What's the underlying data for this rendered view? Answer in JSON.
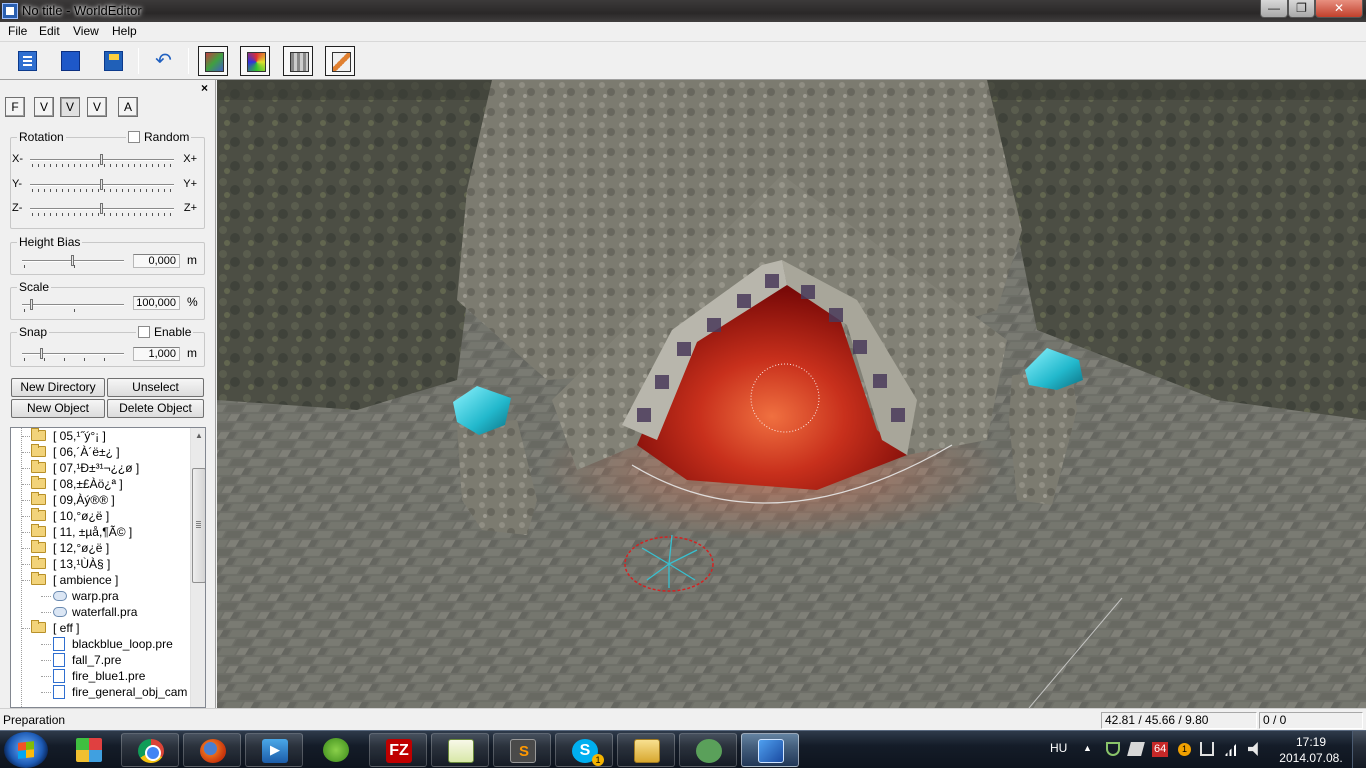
{
  "window": {
    "title": "No title - WorldEditor",
    "minimize_glyph": "—",
    "maximize_glyph": "❐",
    "close_glyph": "✕"
  },
  "menu": [
    "File",
    "Edit",
    "View",
    "Help"
  ],
  "toolbar": {
    "icons": [
      "new-file-icon",
      "open-folder-icon",
      "save-icon",
      "undo-icon",
      "object-mode-icon",
      "texture-mode-icon",
      "attribute-mode-icon",
      "edit-mode-icon"
    ],
    "undo_glyph": "↶"
  },
  "panel": {
    "close_glyph": "×",
    "mode_tabs": [
      "F",
      "V",
      "V",
      "V",
      "A"
    ],
    "rotation": {
      "title": "Rotation",
      "random_label": "Random",
      "random_checked": false,
      "axes": [
        {
          "left": "X-",
          "right": "X+",
          "level": 0.5
        },
        {
          "left": "Y-",
          "right": "Y+",
          "level": 0.5
        },
        {
          "left": "Z-",
          "right": "Z+",
          "level": 0.5
        }
      ]
    },
    "height_bias": {
      "title": "Height Bias",
      "value": "0,000",
      "unit": "m",
      "level": 0.5
    },
    "scale": {
      "title": "Scale",
      "value": "100,000",
      "unit": "%",
      "level": 0.1
    },
    "snap": {
      "title": "Snap",
      "enable_label": "Enable",
      "enable_checked": false,
      "value": "1,000",
      "unit": "m",
      "level": 0.2
    },
    "buttons": {
      "new_directory": "New Directory",
      "unselect": "Unselect",
      "new_object": "New Object",
      "delete_object": "Delete Object"
    },
    "tree": [
      {
        "type": "folder",
        "label": "[ 05,¹˝ý°¡ ]"
      },
      {
        "type": "folder",
        "label": "[ 06,´À´ë±¿ ]"
      },
      {
        "type": "folder",
        "label": "[ 07,¹Ð±³¹¬¿¿ø ]"
      },
      {
        "type": "folder",
        "label": "[ 08,±£Àö¿ª ]"
      },
      {
        "type": "folder",
        "label": "[ 09,Àý®® ]"
      },
      {
        "type": "folder",
        "label": "[ 10,°ø¿ë ]"
      },
      {
        "type": "folder",
        "label": "[ 11, ±µå,¶Ã© ]"
      },
      {
        "type": "folder",
        "label": "[ 12,°ø¿ë ]"
      },
      {
        "type": "folder",
        "label": "[ 13,¹ÙÀ§ ]"
      },
      {
        "type": "folder",
        "label": "[ ambience ]"
      },
      {
        "type": "pra",
        "label": "warp.pra"
      },
      {
        "type": "pra",
        "label": "waterfall.pra"
      },
      {
        "type": "folder",
        "label": "[ eff ]"
      },
      {
        "type": "pre",
        "label": "blackblue_loop.pre"
      },
      {
        "type": "pre",
        "label": "fall_7.pre"
      },
      {
        "type": "pre",
        "label": "fire_blue1.pre"
      },
      {
        "type": "pre",
        "label": "fire_general_obj_cam"
      }
    ],
    "scroll_up_glyph": "▲",
    "scroll_down_glyph": "▼"
  },
  "viewport": {
    "description_colors": {
      "portal": "#c41a12",
      "crystal": "#2ec8d8",
      "stone": "#8a887c",
      "floor": "#6d6e66"
    }
  },
  "status": {
    "text": "Preparation",
    "coords": "42.81 / 45.66 / 9.80",
    "counter": "0 / 0"
  },
  "taskbar": {
    "apps": [
      "start-menu-icon",
      "metro-apps-icon",
      "chrome-icon",
      "firefox-icon",
      "media-player-icon",
      "frog-icon",
      "filezilla-icon",
      "notepad-plus-icon",
      "sublime-text-icon",
      "skype-icon",
      "file-explorer-icon",
      "tortoise-icon",
      "world-editor-icon"
    ],
    "fz_label": "FZ",
    "skype_label": "S",
    "skype_badge": "1",
    "language": "HU",
    "tray_badge_count": "64",
    "tray_alert_badge": "1",
    "time": "17:19",
    "date": "2014.07.08.",
    "tray_expand_glyph": "▲"
  }
}
